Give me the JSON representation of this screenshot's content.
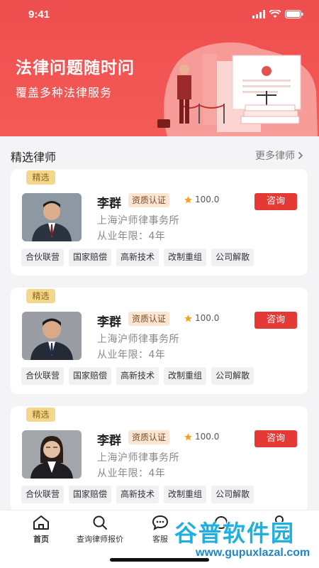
{
  "status_bar": {
    "time": "9:41"
  },
  "banner": {
    "title": "法律问题随时问",
    "subtitle": "覆盖多种法律服务"
  },
  "section": {
    "title": "精选律师",
    "more_label": "更多律师"
  },
  "lawyers": [
    {
      "featured_label": "精选",
      "name": "李群",
      "cert_label": "资质认证",
      "rating": "100.0",
      "consult_label": "咨询",
      "firm": "上海沪师律事务所",
      "years": "从业年限：4年",
      "tags": [
        "合伙联营",
        "国家赔偿",
        "高新技术",
        "改制重组",
        "公司解散"
      ]
    },
    {
      "featured_label": "精选",
      "name": "李群",
      "cert_label": "资质认证",
      "rating": "100.0",
      "consult_label": "咨询",
      "firm": "上海沪师律事务所",
      "years": "从业年限：4年",
      "tags": [
        "合伙联营",
        "国家赔偿",
        "高新技术",
        "改制重组",
        "公司解散"
      ]
    },
    {
      "featured_label": "精选",
      "name": "李群",
      "cert_label": "资质认证",
      "rating": "100.0",
      "consult_label": "咨询",
      "firm": "上海沪师律事务所",
      "years": "从业年限：4年",
      "tags": [
        "合伙联营",
        "国家赔偿",
        "高新技术",
        "改制重组",
        "公司解散"
      ]
    }
  ],
  "nav": {
    "items": [
      {
        "label": "首页",
        "icon": "home-icon",
        "active": true
      },
      {
        "label": "查询律师报价",
        "icon": "search-icon",
        "active": false
      },
      {
        "label": "客服",
        "icon": "chat-icon",
        "active": false
      },
      {
        "label": "",
        "icon": "message-icon",
        "active": false
      },
      {
        "label": "",
        "icon": "user-icon",
        "active": false
      }
    ]
  },
  "watermark": {
    "cn": "谷普软件园",
    "en": "www.gupuxlazal.com"
  },
  "colors": {
    "brand": "#ee4e4e",
    "consult": "#e53935",
    "featured": "#f4d68c"
  }
}
